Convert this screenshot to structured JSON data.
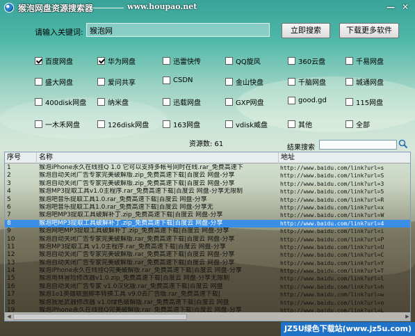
{
  "window": {
    "title": "猴泡网盘资源搜索器",
    "site_url": "www.houpao.net",
    "minimize_glyph": "—",
    "close_glyph": "✕"
  },
  "search": {
    "label": "请输入关键词:",
    "value": "猴泡网",
    "search_button": "立即搜索",
    "more_button": "下载更多软件"
  },
  "sources": [
    {
      "label": "百度网盘",
      "checked": true
    },
    {
      "label": "华为网盘",
      "checked": true
    },
    {
      "label": "迅雷快传",
      "checked": false
    },
    {
      "label": "QQ旋风",
      "checked": false
    },
    {
      "label": "360云盘",
      "checked": false
    },
    {
      "label": "千易网盘",
      "checked": false
    },
    {
      "label": "盛大网盘",
      "checked": false
    },
    {
      "label": "爱问共享",
      "checked": false
    },
    {
      "label": "CSDN",
      "checked": false
    },
    {
      "label": "金山快盘",
      "checked": false
    },
    {
      "label": "千脑网盘",
      "checked": false
    },
    {
      "label": "城通网盘",
      "checked": false
    },
    {
      "label": "400disk网盘",
      "checked": false
    },
    {
      "label": "纳米盘",
      "checked": false
    },
    {
      "label": "迅载网盘",
      "checked": false
    },
    {
      "label": "GXP网盘",
      "checked": false
    },
    {
      "label": "good.gd",
      "checked": false
    },
    {
      "label": "115网盘",
      "checked": false
    },
    {
      "label": "一木禾网盘",
      "checked": false
    },
    {
      "label": "126disk网盘",
      "checked": false
    },
    {
      "label": "163网盘",
      "checked": false
    },
    {
      "label": "vdisk威盘",
      "checked": false
    },
    {
      "label": "其他",
      "checked": false
    },
    {
      "label": "全部",
      "checked": false
    }
  ],
  "result_count": "资源数: 61",
  "result_search": {
    "label": "结果搜索",
    "value": ""
  },
  "table": {
    "headers": {
      "num": "序号",
      "name": "名称",
      "url": "地址"
    },
    "selected_index": 7,
    "rows": [
      {
        "num": "1",
        "name": "猴泡iPhone永久在线挂Q 1.0 它可以支持多帐号同时在线.rar_免费高速下",
        "url": "http://www.baidu.com/link?url=s"
      },
      {
        "num": "2",
        "name": "猴泡自动关闭广告专家完美破解版.zip_免费高速下载|百度云 网盘-分享",
        "url": "http://www.baidu.com/link?url=S"
      },
      {
        "num": "3",
        "name": "猴泡自动关闭广告专家完美破解版.zip_免费高速下载|百度云 网盘-分享",
        "url": "http://www.baidu.com/link?url=3"
      },
      {
        "num": "4",
        "name": "猴泡MP3提取工具v1.0主程序.rar_免费高速下载|百度云 网盘-分享无限制",
        "url": "http://www.baidu.com/link?url=5"
      },
      {
        "num": "5",
        "name": "猴泡吧音乐提取工具1.0.rar_免费高速下载|百度云 网盘-分享",
        "url": "http://www.baidu.com/link?url=R"
      },
      {
        "num": "6",
        "name": "猴泡吧音乐提取工具1.0.rar_免费高速下载|百度云 网盘-分享无",
        "url": "http://www.baidu.com/link?url=x"
      },
      {
        "num": "7",
        "name": "猴泡吧MP3提取工具破解补丁.zip_免费高速下载|百度云 网盘-分享",
        "url": "http://www.baidu.com/link?url=W"
      },
      {
        "num": "8",
        "name": "猴泡吧MP3提取工具破解补丁.zip_免费高速下载|百度云 网盘-分享",
        "url": "http://www.baidu.com/link?url=4"
      },
      {
        "num": "9",
        "name": "猴泡网吧MP3提取工具破解补丁.zip_免费高速下载|百度云 网盘-分享",
        "url": "http://www.baidu.com/link?url=i"
      },
      {
        "num": "10",
        "name": "猴泡自动关闭广告专家完美破解版.rar_免费高速下载|百度云 网盘-分享",
        "url": "http://www.baidu.com/link?url=P"
      },
      {
        "num": "11",
        "name": "猴泡MP3提取工具 v1.0主程序.rar_免费高速下载|百度云 网盘-分享",
        "url": "http://www.baidu.com/link?url=U"
      },
      {
        "num": "12",
        "name": "猴泡自动关闭广告专家完美破解版.rar_免费高速下载|百度云 网盘-分享",
        "url": "http://www.baidu.com/link?url=C"
      },
      {
        "num": "13",
        "name": "猴泡自动关闭广告专家完美破解版.rar_免费高速下载|百度云 网盘-分享",
        "url": "http://www.baidu.com/link?url=Y"
      },
      {
        "num": "14",
        "name": "猴泡iPhone永久在线挂Q完美破解版.rar_免费高速下载|百度云 网盘-分享",
        "url": "http://www.baidu.com/link?url=T"
      },
      {
        "num": "15",
        "name": "猴泡雨林冒险修改器v1.0.zip_免费高速下载|百度云 网盘-分享无限制",
        "url": "http://www.baidu.com/link?url=l"
      },
      {
        "num": "16",
        "name": "猴泡自动关闭广告专家 v1.0汉化版.rar_免费高速下载|百度云 网盘",
        "url": "http://www.baidu.com/link?url=h"
      },
      {
        "num": "17",
        "name": "猴泡1o1英雄联盟脚本转换工具 v9.0去广告版.rar_免费高速下载|",
        "url": "http://www.baidu.com/link?url=w"
      },
      {
        "num": "18",
        "name": "猴泡我是武器修改器 v1.0绿色破解版.rar_免费高速下载|百度云 网盘",
        "url": "http://www.baidu.com/link?url=o"
      },
      {
        "num": "19",
        "name": "猴泡iPhone永久在线挂Q完美破解版.rar_免费高速下载|百度云 网盘-分享",
        "url": "http://www.baidu.com/link?url=L"
      }
    ]
  },
  "watermark": "JZ5U绿色下载站(www.jz5u.com)"
}
